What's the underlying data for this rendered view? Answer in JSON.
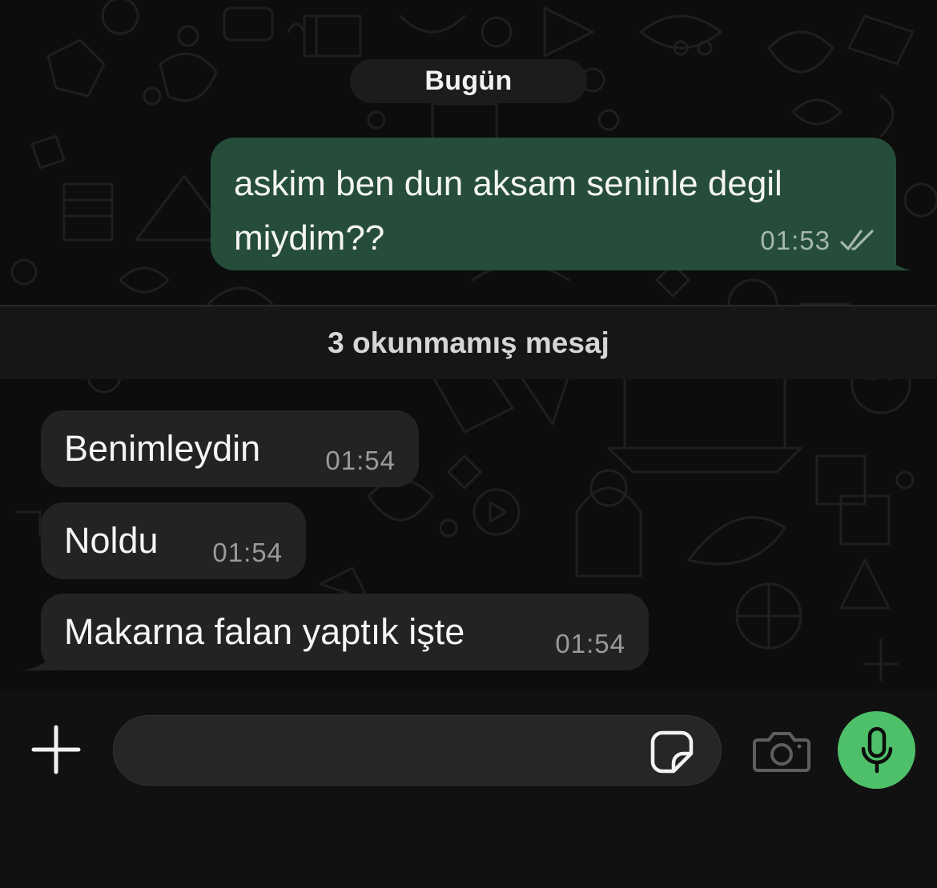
{
  "chat": {
    "date_label": "Bugün",
    "unread_label": "3 okunmamış mesaj",
    "outgoing": [
      {
        "text": "askim ben dun aksam seninle degil miydim??",
        "time": "01:53",
        "status": "read"
      }
    ],
    "incoming": [
      {
        "text": "Benimleydin",
        "time": "01:54"
      },
      {
        "text": "Noldu",
        "time": "01:54"
      },
      {
        "text": "Makarna falan yaptık işte",
        "time": "01:54"
      }
    ]
  },
  "composer": {
    "input_value": "",
    "icons": {
      "attach": "plus-icon",
      "sticker": "sticker-icon",
      "camera": "camera-icon",
      "voice": "microphone-icon"
    }
  },
  "colors": {
    "outgoing_bubble": "#254d3a",
    "incoming_bubble": "#232323",
    "mic_button": "#4fc06a",
    "background": "#0d0d0d"
  }
}
